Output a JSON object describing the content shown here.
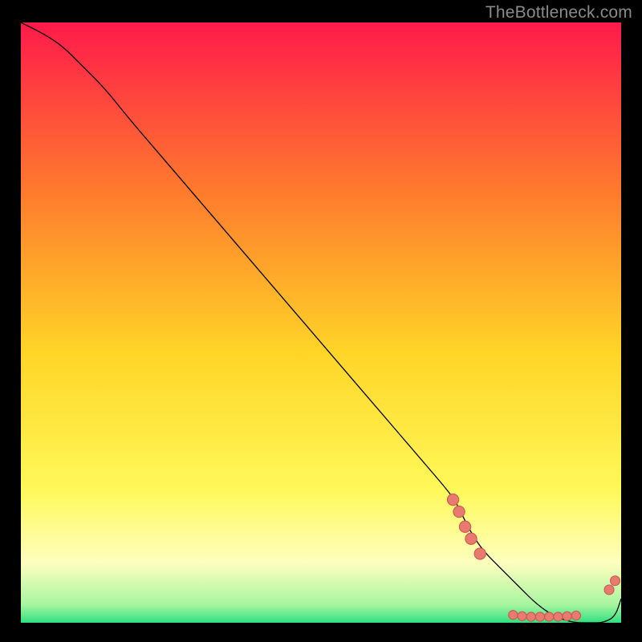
{
  "watermark": "TheBottleneck.com",
  "colors": {
    "gradient_top": "#ff1a4b",
    "gradient_upper_mid": "#ff7a2d",
    "gradient_mid": "#ffd527",
    "gradient_lower_mid": "#fff95a",
    "gradient_pale_yellow": "#feffbe",
    "gradient_green": "#2fe07f",
    "curve": "#000000",
    "marker_fill": "#e87a6f",
    "marker_stroke": "#c95b4f"
  },
  "chart_data": {
    "type": "line",
    "title": "",
    "xlabel": "",
    "ylabel": "",
    "xlim": [
      0,
      100
    ],
    "ylim": [
      0,
      100
    ],
    "grid": false,
    "series": [
      {
        "name": "curve",
        "x": [
          0,
          4,
          7,
          10,
          14,
          18,
          24,
          30,
          36,
          42,
          48,
          54,
          60,
          66,
          72,
          73,
          75,
          77,
          80,
          83,
          86,
          89,
          92,
          95,
          97,
          99,
          100
        ],
        "y": [
          100,
          98,
          96,
          93,
          89,
          84,
          77,
          70,
          63,
          56,
          49,
          42,
          35,
          28,
          21,
          19,
          15,
          12,
          9,
          6,
          3,
          1,
          0,
          0,
          0,
          1,
          4
        ]
      }
    ],
    "markers_cluster1": [
      {
        "x": 72.0,
        "y": 20.5
      },
      {
        "x": 73.0,
        "y": 18.5
      },
      {
        "x": 74.0,
        "y": 16.0
      },
      {
        "x": 75.0,
        "y": 14.0
      },
      {
        "x": 76.5,
        "y": 11.5
      }
    ],
    "markers_bottom": [
      {
        "x": 82.0,
        "y": 1.3
      },
      {
        "x": 83.5,
        "y": 1.1
      },
      {
        "x": 85.0,
        "y": 1.0
      },
      {
        "x": 86.5,
        "y": 1.0
      },
      {
        "x": 88.0,
        "y": 1.0
      },
      {
        "x": 89.5,
        "y": 1.0
      },
      {
        "x": 91.0,
        "y": 1.1
      },
      {
        "x": 92.5,
        "y": 1.2
      }
    ],
    "markers_right": [
      {
        "x": 98.0,
        "y": 5.5
      },
      {
        "x": 99.0,
        "y": 7.0
      }
    ]
  }
}
